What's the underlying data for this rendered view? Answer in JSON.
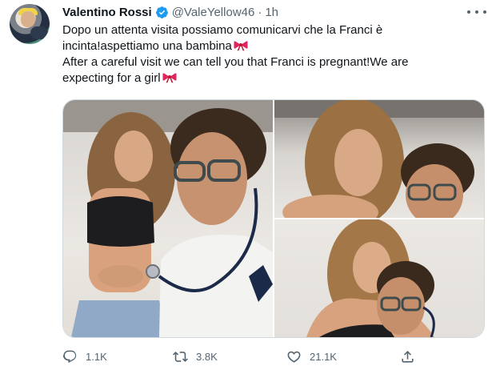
{
  "tweet": {
    "author_name": "Valentino Rossi",
    "handle": "@ValeYellow46",
    "separator": "·",
    "time": "1h",
    "verified": true,
    "text_lines": [
      "Dopo un attenta visita possiamo comunicarvi che la Franci è",
      "incinta!aspettiamo una bambina",
      "After a careful visit we can tell you that Franci is pregnant!We are",
      "expecting for a girl"
    ],
    "emoji": "ribbon"
  },
  "actions": {
    "reply_count": "1.1K",
    "retweet_count": "3.8K",
    "like_count": "21.1K"
  },
  "colors": {
    "text": "#0f1419",
    "secondary": "#536471",
    "verified": "#1d9bf0",
    "ribbon": "#e0245e",
    "border": "#cfd9de"
  },
  "icons": [
    "more-icon",
    "verified-badge-icon",
    "ribbon-icon",
    "reply-icon",
    "retweet-icon",
    "like-icon",
    "share-icon"
  ]
}
